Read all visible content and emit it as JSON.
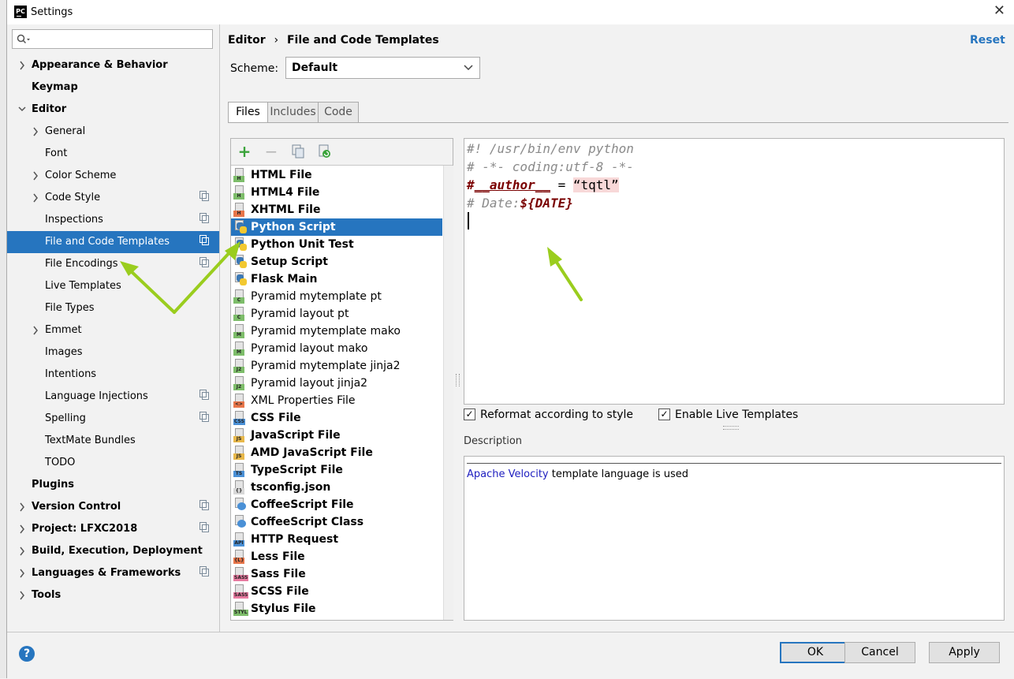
{
  "window": {
    "title": "Settings",
    "app_icon": "PC",
    "close_label": "✕"
  },
  "search": {
    "placeholder": ""
  },
  "tree": [
    {
      "label": "Appearance & Behavior",
      "bold": true,
      "level": 0,
      "expander": "›",
      "copy": false
    },
    {
      "label": "Keymap",
      "bold": true,
      "level": 0,
      "expander": "",
      "copy": false
    },
    {
      "label": "Editor",
      "bold": true,
      "level": 0,
      "expander": "⌄",
      "copy": false
    },
    {
      "label": "General",
      "bold": false,
      "level": 1,
      "expander": "›",
      "copy": false
    },
    {
      "label": "Font",
      "bold": false,
      "level": 1,
      "expander": "",
      "copy": false
    },
    {
      "label": "Color Scheme",
      "bold": false,
      "level": 1,
      "expander": "›",
      "copy": false
    },
    {
      "label": "Code Style",
      "bold": false,
      "level": 1,
      "expander": "›",
      "copy": true
    },
    {
      "label": "Inspections",
      "bold": false,
      "level": 1,
      "expander": "",
      "copy": true
    },
    {
      "label": "File and Code Templates",
      "bold": false,
      "level": 1,
      "expander": "",
      "copy": true,
      "selected": true
    },
    {
      "label": "File Encodings",
      "bold": false,
      "level": 1,
      "expander": "",
      "copy": true
    },
    {
      "label": "Live Templates",
      "bold": false,
      "level": 1,
      "expander": "",
      "copy": false
    },
    {
      "label": "File Types",
      "bold": false,
      "level": 1,
      "expander": "",
      "copy": false
    },
    {
      "label": "Emmet",
      "bold": false,
      "level": 1,
      "expander": "›",
      "copy": false
    },
    {
      "label": "Images",
      "bold": false,
      "level": 1,
      "expander": "",
      "copy": false
    },
    {
      "label": "Intentions",
      "bold": false,
      "level": 1,
      "expander": "",
      "copy": false
    },
    {
      "label": "Language Injections",
      "bold": false,
      "level": 1,
      "expander": "",
      "copy": true
    },
    {
      "label": "Spelling",
      "bold": false,
      "level": 1,
      "expander": "",
      "copy": true
    },
    {
      "label": "TextMate Bundles",
      "bold": false,
      "level": 1,
      "expander": "",
      "copy": false
    },
    {
      "label": "TODO",
      "bold": false,
      "level": 1,
      "expander": "",
      "copy": false
    },
    {
      "label": "Plugins",
      "bold": true,
      "level": 0,
      "expander": "",
      "copy": false
    },
    {
      "label": "Version Control",
      "bold": true,
      "level": 0,
      "expander": "›",
      "copy": true
    },
    {
      "label": "Project: LFXC2018",
      "bold": true,
      "level": 0,
      "expander": "›",
      "copy": true
    },
    {
      "label": "Build, Execution, Deployment",
      "bold": true,
      "level": 0,
      "expander": "›",
      "copy": false
    },
    {
      "label": "Languages & Frameworks",
      "bold": true,
      "level": 0,
      "expander": "›",
      "copy": true
    },
    {
      "label": "Tools",
      "bold": true,
      "level": 0,
      "expander": "›",
      "copy": false
    }
  ],
  "breadcrumb": {
    "parent": "Editor",
    "separator": "›",
    "current": "File and Code Templates"
  },
  "reset_label": "Reset",
  "scheme": {
    "label": "Scheme:",
    "value": "Default"
  },
  "tabs": [
    {
      "label": "Files",
      "active": true
    },
    {
      "label": "Includes",
      "active": false
    },
    {
      "label": "Code",
      "active": false
    }
  ],
  "toolbar": {
    "add": "+",
    "remove": "−",
    "copy_icon": "copy-icon",
    "reset_icon": "reset-icon"
  },
  "files": [
    {
      "name": "HTML File",
      "badge": "H",
      "color": "#7dbd6a",
      "bold": true
    },
    {
      "name": "HTML4 File",
      "badge": "H",
      "color": "#7dbd6a",
      "bold": true
    },
    {
      "name": "XHTML File",
      "badge": "H",
      "color": "#e8764a",
      "bold": true
    },
    {
      "name": "Python Script",
      "badge": "py",
      "color": "#3b78b5",
      "bold": true,
      "selected": true
    },
    {
      "name": "Python Unit Test",
      "badge": "py",
      "color": "#3b78b5",
      "bold": true
    },
    {
      "name": "Setup Script",
      "badge": "py",
      "color": "#3b78b5",
      "bold": true
    },
    {
      "name": "Flask Main",
      "badge": "py",
      "color": "#3b78b5",
      "bold": true
    },
    {
      "name": "Pyramid mytemplate pt",
      "badge": "C",
      "color": "#7dbd6a",
      "bold": false
    },
    {
      "name": "Pyramid layout pt",
      "badge": "C",
      "color": "#7dbd6a",
      "bold": false
    },
    {
      "name": "Pyramid mytemplate mako",
      "badge": "M",
      "color": "#7dbd6a",
      "bold": false
    },
    {
      "name": "Pyramid layout mako",
      "badge": "M",
      "color": "#7dbd6a",
      "bold": false
    },
    {
      "name": "Pyramid mytemplate jinja2",
      "badge": "J2",
      "color": "#7dbd6a",
      "bold": false
    },
    {
      "name": "Pyramid layout jinja2",
      "badge": "J2",
      "color": "#7dbd6a",
      "bold": false
    },
    {
      "name": "XML Properties File",
      "badge": "<>",
      "color": "#e8764a",
      "bold": false
    },
    {
      "name": "CSS File",
      "badge": "CSS",
      "color": "#4a90d6",
      "bold": true
    },
    {
      "name": "JavaScript File",
      "badge": "JS",
      "color": "#e8b84a",
      "bold": true
    },
    {
      "name": "AMD JavaScript File",
      "badge": "JS",
      "color": "#e8b84a",
      "bold": true
    },
    {
      "name": "TypeScript File",
      "badge": "TS",
      "color": "#4a90d6",
      "bold": true
    },
    {
      "name": "tsconfig.json",
      "badge": "{}",
      "color": "#d8d8d8",
      "bold": true
    },
    {
      "name": "CoffeeScript File",
      "badge": "cs",
      "color": "#4a90d6",
      "bold": true
    },
    {
      "name": "CoffeeScript Class",
      "badge": "cs",
      "color": "#4a90d6",
      "bold": true
    },
    {
      "name": "HTTP Request",
      "badge": "API",
      "color": "#4a90d6",
      "bold": true
    },
    {
      "name": "Less File",
      "badge": "{L}",
      "color": "#e8764a",
      "bold": true
    },
    {
      "name": "Sass File",
      "badge": "SASS",
      "color": "#e87aa0",
      "bold": true
    },
    {
      "name": "SCSS File",
      "badge": "SASS",
      "color": "#e87aa0",
      "bold": true
    },
    {
      "name": "Stylus File",
      "badge": "STYL",
      "color": "#7dbd6a",
      "bold": true
    }
  ],
  "editor": {
    "line1": "#! /usr/bin/env python",
    "line2": "# -*- coding:utf-8 -*-",
    "line3_a": "#",
    "line3_b": "__author__",
    "line3_c": " = ",
    "line3_d": "“tqtl”",
    "line4_a": "# Date:",
    "line4_b": "${DATE}"
  },
  "options": {
    "reformat_label": "Reformat according to style",
    "reformat_checked": true,
    "live_label": "Enable Live Templates",
    "live_checked": true
  },
  "description": {
    "label": "Description",
    "link_text": "Apache Velocity",
    "rest_text": " template language is used"
  },
  "buttons": {
    "ok": "OK",
    "cancel": "Cancel",
    "apply": "Apply",
    "help": "?"
  },
  "colors": {
    "accent": "#2675bf",
    "arrow": "#9acd1e"
  }
}
